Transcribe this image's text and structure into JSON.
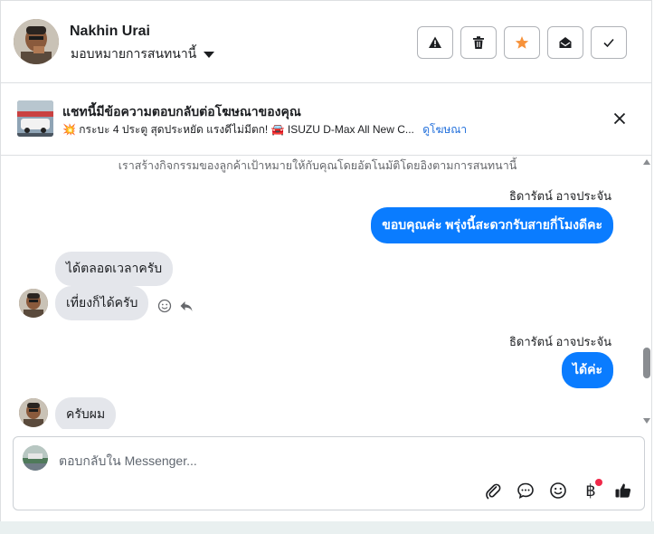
{
  "header": {
    "name": "Nakhin Urai",
    "assign_label": "มอบหมายการสนทนานี้",
    "actions": [
      "report-icon",
      "trash-icon",
      "star-icon",
      "mark-unread-icon",
      "check-icon"
    ],
    "star_color": "#f7923a"
  },
  "ad": {
    "title": "แชทนี้มีข้อความตอบกลับต่อโฆษณาของคุณ",
    "summary": "💥 กระบะ 4 ประตู สุดประหยัด แรงดีไม่มีตก! 🚘 ISUZU D-Max All New C...",
    "view_link": "ดูโฆษณา"
  },
  "chat": {
    "system_note": "เราสร้างกิจกรรมของลูกค้าเป้าหมายให้กับคุณโดยอัตโนมัติโดยอิงตามการสนทนานี้",
    "messages": [
      {
        "sender_label": "ธิดารัตน์ อาจประจัน",
        "text": "ขอบคุณค่ะ พรุ่งนี้สะดวกรับสายกี่โมงดีคะ"
      },
      {
        "text": "ได้ตลอดเวลาครับ"
      },
      {
        "text": "เที่ยงก็ได้ครับ"
      },
      {
        "sender_label": "ธิดารัตน์ อาจประจัน",
        "text": "ได้ค่ะ"
      },
      {
        "text": "ครับผม"
      }
    ],
    "outgoing_color": "#0a7cff",
    "incoming_color": "#e4e6eb"
  },
  "composer": {
    "placeholder": "ตอบกลับใน Messenger...",
    "tools": [
      "attach-icon",
      "saved-reply-icon",
      "emoji-icon",
      "payment-icon",
      "like-icon"
    ],
    "payment_symbol": "฿"
  }
}
